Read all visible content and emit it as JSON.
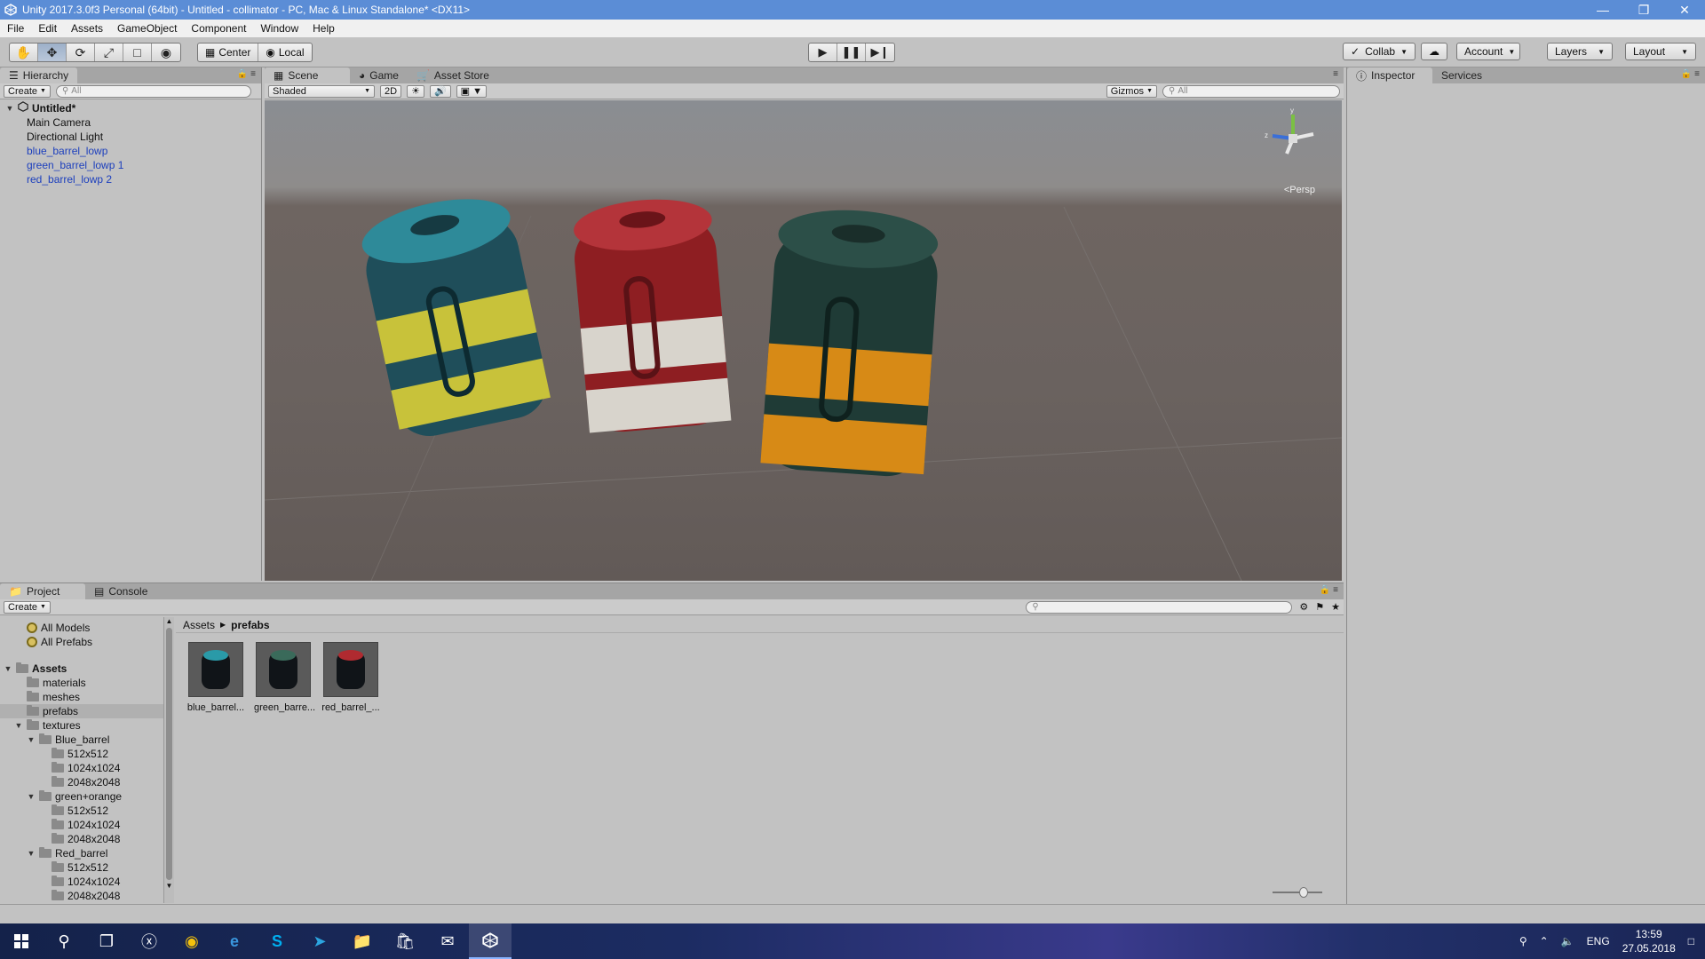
{
  "window": {
    "title": "Unity 2017.3.0f3 Personal (64bit) - Untitled - collimator - PC, Mac & Linux Standalone* <DX11>"
  },
  "menu": [
    "File",
    "Edit",
    "Assets",
    "GameObject",
    "Component",
    "Window",
    "Help"
  ],
  "toolbar": {
    "pivot_center": "Center",
    "pivot_local": "Local",
    "collab": "Collab",
    "account": "Account",
    "layers": "Layers",
    "layout": "Layout"
  },
  "hierarchy": {
    "tab": "Hierarchy",
    "create": "Create",
    "search_placeholder": "All",
    "scene": "Untitled*",
    "objects": [
      {
        "name": "Main Camera",
        "prefab": false
      },
      {
        "name": "Directional Light",
        "prefab": false
      },
      {
        "name": "blue_barrel_lowp",
        "prefab": true
      },
      {
        "name": "green_barrel_lowp 1",
        "prefab": true
      },
      {
        "name": "red_barrel_lowp 2",
        "prefab": true
      }
    ]
  },
  "scene_tabs": [
    "Scene",
    "Game",
    "Asset Store"
  ],
  "scene_bar": {
    "shading": "Shaded",
    "mode_2d": "2D",
    "gizmos": "Gizmos",
    "search_placeholder": "All",
    "persp": "Persp"
  },
  "barrels": [
    {
      "name": "blue",
      "body": "#1f4e5a",
      "band": "#c8c23a",
      "top": "#2e8a99"
    },
    {
      "name": "red",
      "body": "#8e1e22",
      "band": "#d8d4cc",
      "top": "#b4343a"
    },
    {
      "name": "green",
      "body": "#1f3b36",
      "band": "#d78a16",
      "top": "#2c4f48"
    }
  ],
  "inspector": {
    "tabs": [
      "Inspector",
      "Services"
    ]
  },
  "project": {
    "tabs": [
      "Project",
      "Console"
    ],
    "create": "Create",
    "favorites": [
      "All Models",
      "All Prefabs"
    ],
    "tree": {
      "root": "Assets",
      "folders": [
        "materials",
        "meshes",
        "prefabs",
        "textures"
      ],
      "selected": "prefabs",
      "texture_groups": [
        {
          "name": "Blue_barrel",
          "sizes": [
            "512x512",
            "1024x1024",
            "2048x2048"
          ]
        },
        {
          "name": "green+orange",
          "sizes": [
            "512x512",
            "1024x1024",
            "2048x2048"
          ]
        },
        {
          "name": "Red_barrel",
          "sizes": [
            "512x512",
            "1024x1024",
            "2048x2048"
          ]
        }
      ]
    },
    "breadcrumb": [
      "Assets",
      "prefabs"
    ],
    "assets": [
      {
        "label": "blue_barrel...",
        "color": "#2a9aa8"
      },
      {
        "label": "green_barre...",
        "color": "#3a6a5a"
      },
      {
        "label": "red_barrel_...",
        "color": "#b02a30"
      }
    ]
  },
  "taskbar": {
    "lang": "ENG",
    "time": "13:59",
    "date": "27.05.2018"
  }
}
